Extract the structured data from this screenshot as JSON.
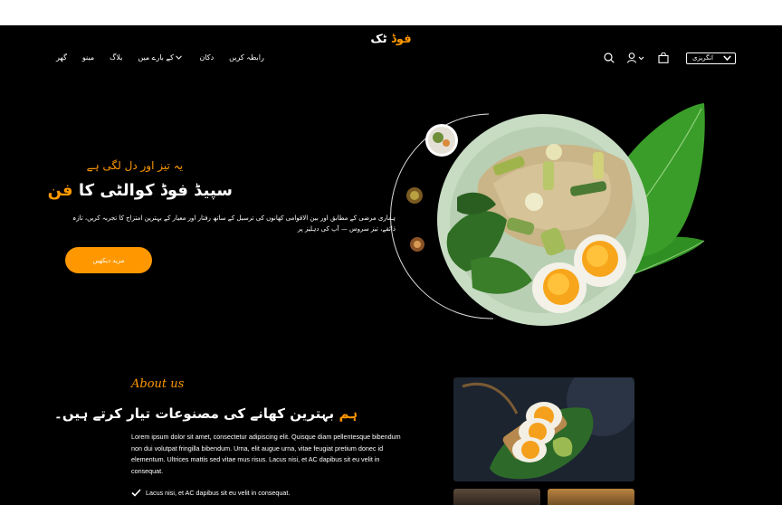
{
  "header": {
    "logo_part_orange": "فوڈ",
    "logo_part_white": "ٹک",
    "nav": [
      {
        "label": "گھر"
      },
      {
        "label": "مینو"
      },
      {
        "label": "بلاگ"
      },
      {
        "label": "کے بارے میں"
      },
      {
        "label": "دکان"
      },
      {
        "label": "رابطہ کریں"
      }
    ],
    "language": "انگریزی"
  },
  "hero": {
    "tagline": "یہ تیز اور دل لگی ہے",
    "title_main": "سپیڈ فوڈ کوالٹی کا",
    "title_accent": "فن",
    "description": "ہماری مرضی کے مطابق اور بین الاقوامی کھانوں کی ترسیل کے ساتھ رفتار اور معیار کے بہترین امتزاج کا تجربہ کریں، تازہ ذائقے، تیز سروس — آپ کی دہلیز پر",
    "cta": "مزید دیکھیں"
  },
  "about": {
    "script": "About us",
    "title_accent": "ہم",
    "title_rest": "بہترین کھانے کی مصنوعات تیار کرتے ہیں۔",
    "body": "Lorem ipsum dolor sit amet, consectetur adipiscing elit. Quisque diam pellentesque bibendum non dui volutpat fringilla bibendum. Urna, elit augue urna, vitae feugiat pretium donec id elementum. Ultrices mattis sed vitae mus risus. Lacus nisi, et AC dapibus sit eu velit in consequat.",
    "check": "Lacus nisi, et AC dapibus sit eu velit in consequat."
  },
  "colors": {
    "accent": "#ff9800",
    "background": "#000000",
    "plate": "#c8dcc6",
    "leaf": "#3a9a2a"
  }
}
